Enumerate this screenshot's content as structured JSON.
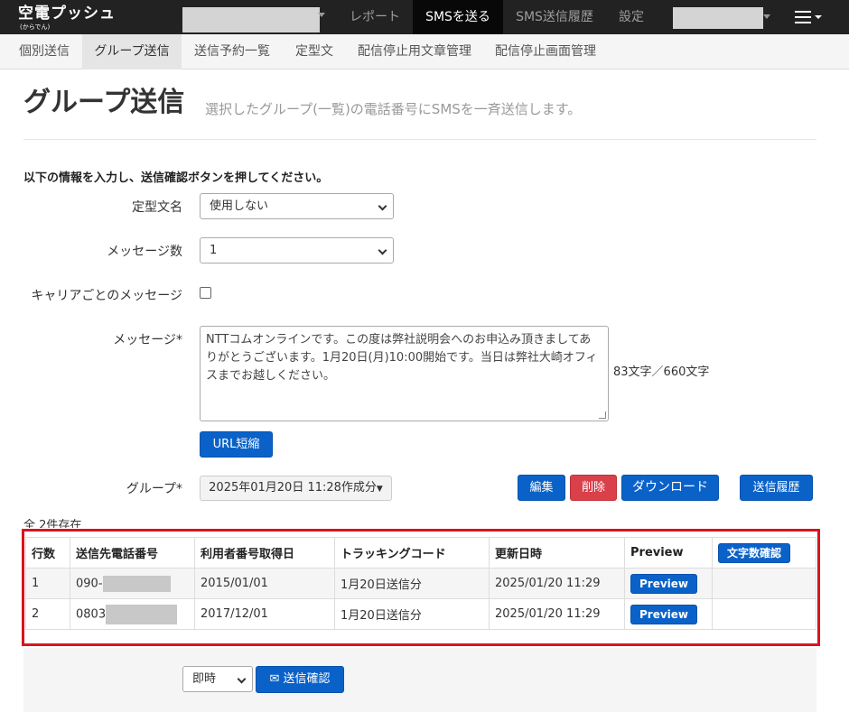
{
  "navbar": {
    "brand": "空電プッシュ",
    "brand_sub": "(からでん)",
    "items": [
      {
        "label": "レポート"
      },
      {
        "label": "SMSを送る"
      },
      {
        "label": "SMS送信履歴"
      },
      {
        "label": "設定"
      }
    ],
    "active_item": "SMSを送る"
  },
  "subnav": {
    "items": [
      {
        "label": "個別送信"
      },
      {
        "label": "グループ送信"
      },
      {
        "label": "送信予約一覧"
      },
      {
        "label": "定型文"
      },
      {
        "label": "配信停止用文章管理"
      },
      {
        "label": "配信停止画面管理"
      }
    ],
    "active_item": "グループ送信"
  },
  "header": {
    "title": "グループ送信",
    "subtitle": "選択したグループ(一覧)の電話番号にSMSを一斉送信します。"
  },
  "form": {
    "intro": "以下の情報を入力し、送信確認ボタンを押してください。",
    "template_label": "定型文名",
    "template_value": "使用しない",
    "message_count_label": "メッセージ数",
    "message_count_value": "1",
    "carrier_label": "キャリアごとのメッセージ",
    "carrier_checked": false,
    "message_label": "メッセージ*",
    "message_value": "NTTコムオンラインです。この度は弊社説明会へのお申込み頂きましてありがとうございます。1月20日(月)10:00開始です。当日は弊社大崎オフィスまでお越しください。",
    "char_count": "83文字／660文字",
    "url_shorten_button": "URL短縮",
    "group_label": "グループ*",
    "group_value": "2025年01月20日 11:28作成分"
  },
  "actions": {
    "edit": "編集",
    "delete": "削除",
    "download": "ダウンロード",
    "history": "送信履歴"
  },
  "table": {
    "count_text": "全 2件存在",
    "headers": [
      "行数",
      "送信先電話番号",
      "利用者番号取得日",
      "トラッキングコード",
      "更新日時",
      "Preview"
    ],
    "char_check_button": "文字数確認",
    "rows": [
      {
        "no": "1",
        "phone": "090-",
        "acquired": "2015/01/01",
        "tracking": "1月20日送信分",
        "updated": "2025/01/20 11:29",
        "preview": "Preview"
      },
      {
        "no": "2",
        "phone": "0803",
        "acquired": "2017/12/01",
        "tracking": "1月20日送信分",
        "updated": "2025/01/20 11:29",
        "preview": "Preview"
      }
    ]
  },
  "footer": {
    "timing_value": "即時",
    "send_confirm_button": "送信確認"
  },
  "colors": {
    "navbar_bg": "#222222",
    "primary": "#0a62c9",
    "danger": "#d9404a",
    "highlight_frame": "#d9141d"
  },
  "icons": {
    "menu": "hamburger-menu-icon",
    "send": "envelope-icon"
  }
}
